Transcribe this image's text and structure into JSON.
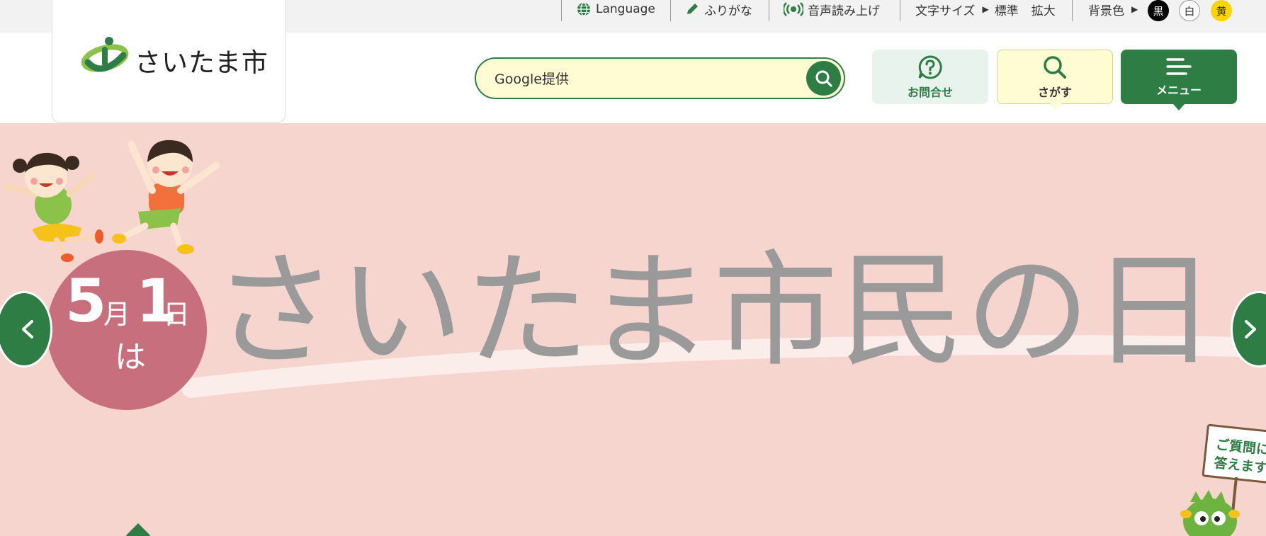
{
  "colors": {
    "accent": "#2e7d45",
    "topbar_bg": "#f2f2f2",
    "search_bg": "#fffbd2",
    "hero_bg": "#f7d5cf",
    "badge": "#c86f7e",
    "title_gray": "#9a9a9a",
    "inquiry_bg": "#e8f3ee",
    "search_btn_bg": "#fffbd2",
    "menu_bg": "#2e7d45"
  },
  "topbar": {
    "language": "Language",
    "furigana": "ふりがな",
    "read_aloud": "音声読み上げ",
    "font_size": {
      "label": "文字サイズ",
      "standard": "標準",
      "enlarge": "拡大"
    },
    "bg_color": {
      "label": "背景色",
      "options": [
        "黒",
        "白",
        "黄"
      ]
    }
  },
  "header": {
    "logo_text": "さいたま市",
    "search_placeholder": "Google提供",
    "buttons": {
      "inquiry": "お問合せ",
      "search": "さがす",
      "menu": "メニュー"
    }
  },
  "hero": {
    "date_num_month": "5",
    "date_month_char": "月",
    "date_num_day": "1",
    "date_day_char": "日",
    "date_suffix": "は",
    "title": "さいたま市民の日",
    "sign_line1": "ご質問に",
    "sign_line2": "答えます"
  }
}
